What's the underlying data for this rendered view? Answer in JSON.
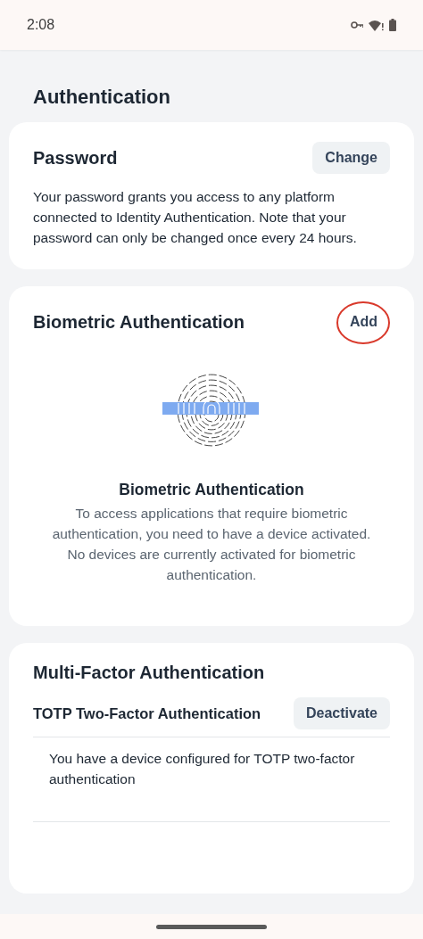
{
  "status_bar": {
    "time": "2:08"
  },
  "page": {
    "title": "Authentication"
  },
  "password": {
    "title": "Password",
    "button": "Change",
    "description": "Your password grants you access to any platform connected to Identity Authentication. Note that your password can only be changed once every 24 hours."
  },
  "biometric": {
    "title": "Biometric Authentication",
    "button": "Add",
    "button_highlighted": true,
    "empty_title": "Biometric Authentication",
    "empty_text": "To access applications that require biometric authentication, you need to have a device activated. No devices are currently activated for biometric authentication."
  },
  "mfa": {
    "title": "Multi-Factor Authentication",
    "items": [
      {
        "title": "TOTP Two-Factor Authentication",
        "button": "Deactivate",
        "description": "You have a device configured for TOTP two-factor authentication"
      }
    ]
  }
}
